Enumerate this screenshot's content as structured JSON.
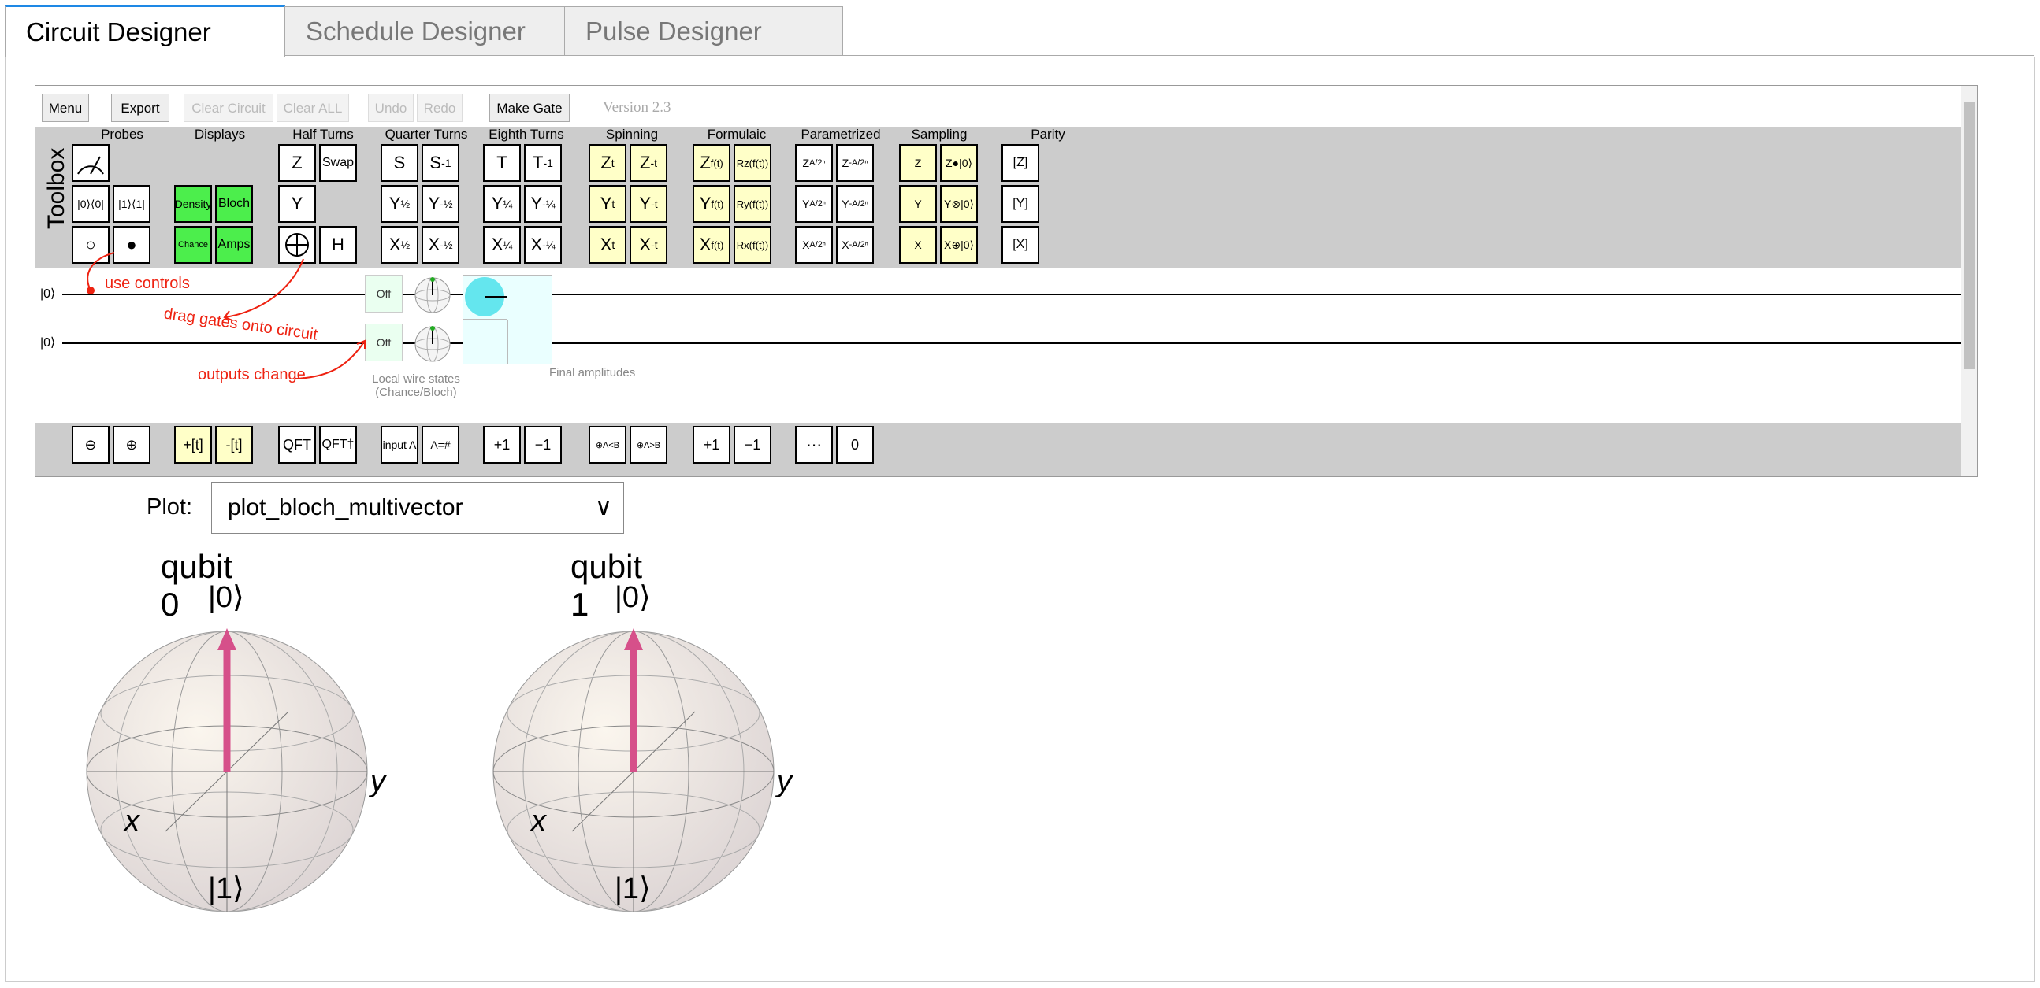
{
  "tabs": [
    "Circuit Designer",
    "Schedule Designer",
    "Pulse Designer"
  ],
  "toolbar": {
    "menu": "Menu",
    "export": "Export",
    "clear_circuit": "Clear Circuit",
    "clear_all": "Clear ALL",
    "undo": "Undo",
    "redo": "Redo",
    "make_gate": "Make Gate",
    "version": "Version 2.3"
  },
  "toolbox": {
    "title": "Toolbox",
    "groups": [
      "Probes",
      "Displays",
      "Half Turns",
      "Quarter Turns",
      "Eighth Turns",
      "Spinning",
      "Formulaic",
      "Parametrized",
      "Sampling",
      "Parity"
    ]
  },
  "circuit": {
    "wire0": "|0⟩",
    "wire1": "|0⟩",
    "off": "Off",
    "ann_controls": "use controls",
    "ann_drag": "drag gates onto circuit",
    "ann_outputs": "outputs change",
    "local_states": "Local wire states",
    "local_states2": "(Chance/Bloch)",
    "final_amps": "Final amplitudes"
  },
  "plot": {
    "label": "Plot:",
    "selected": "plot_bloch_multivector"
  },
  "bloch": [
    {
      "title": "qubit 0",
      "top": "|0⟩",
      "bottom": "|1⟩",
      "x": "x",
      "y": "y"
    },
    {
      "title": "qubit 1",
      "top": "|0⟩",
      "bottom": "|1⟩",
      "x": "x",
      "y": "y"
    }
  ]
}
